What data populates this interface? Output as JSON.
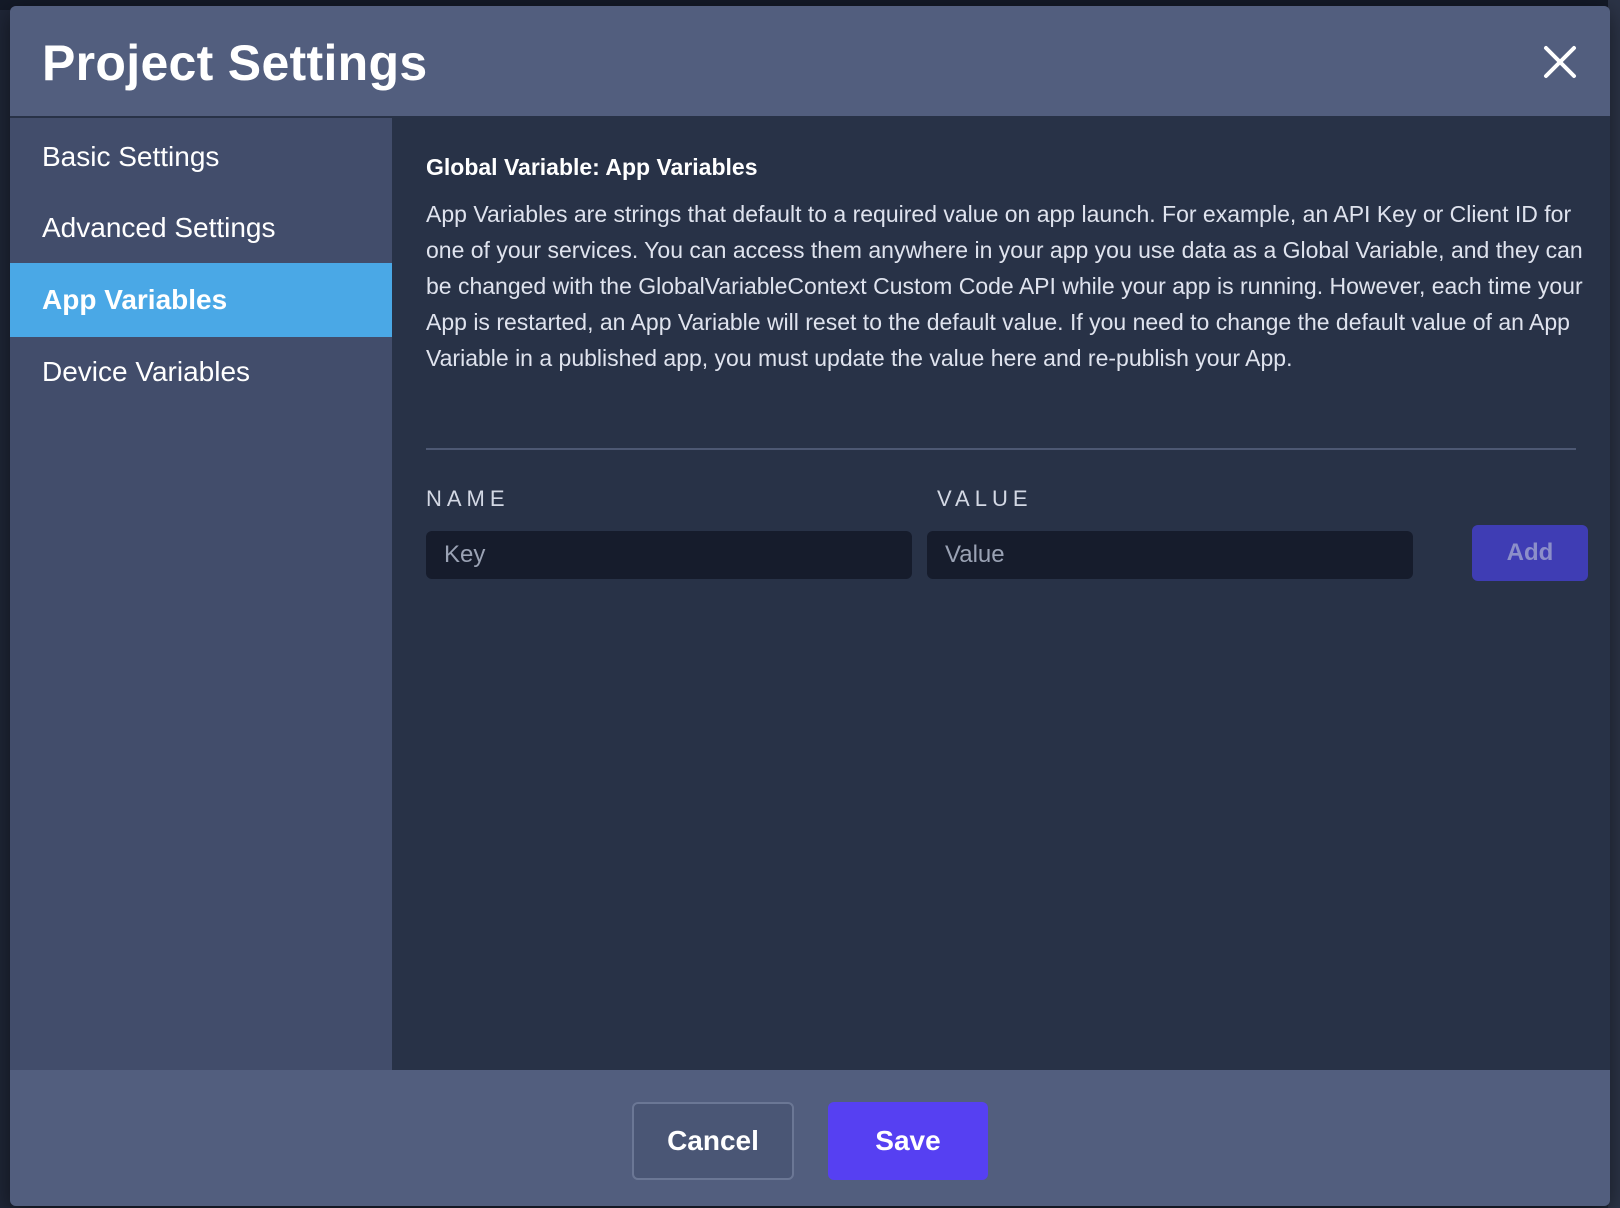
{
  "dialog": {
    "title": "Project Settings"
  },
  "sidebar": {
    "items": [
      {
        "label": "Basic Settings",
        "active": false
      },
      {
        "label": "Advanced Settings",
        "active": false
      },
      {
        "label": "App Variables",
        "active": true
      },
      {
        "label": "Device Variables",
        "active": false
      }
    ]
  },
  "main": {
    "section_title": "Global Variable: App Variables",
    "description": "App Variables are strings that default to a required value on app launch. For example, an API Key or Client ID for one of your services. You can access them anywhere in your app you use data as a Global Variable, and they can be changed with the GlobalVariableContext Custom Code API while your app is running. However, each time your App is restarted, an App Variable will reset to the default value. If you need to change the default value of an App Variable in a published app, you must update the value here and re-publish your App.",
    "name_label": "NAME",
    "value_label": "VALUE",
    "name_placeholder": "Key",
    "value_placeholder": "Value",
    "add_label": "Add"
  },
  "footer": {
    "cancel_label": "Cancel",
    "save_label": "Save"
  },
  "colors": {
    "header_bg": "#525e7e",
    "sidebar_bg": "#424d6b",
    "active_item": "#4aa8e6",
    "content_bg": "#283247",
    "save_button": "#5640f2",
    "add_button": "#3f3db4"
  }
}
